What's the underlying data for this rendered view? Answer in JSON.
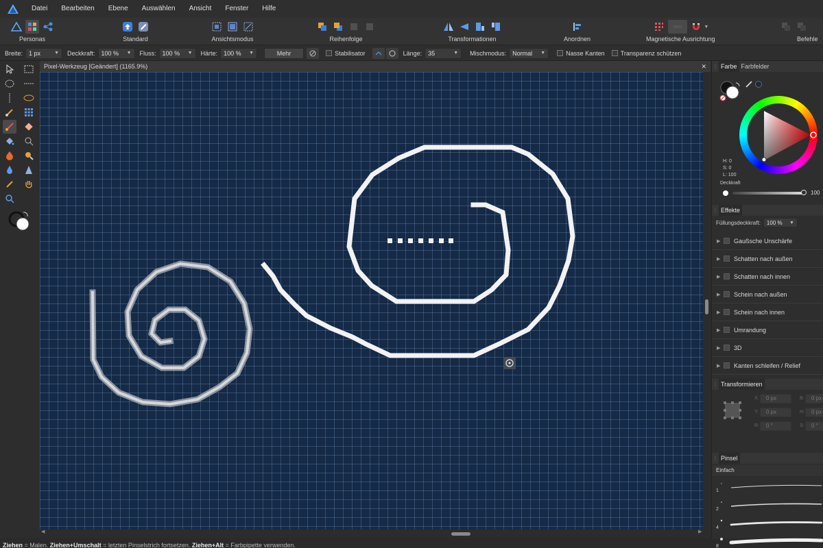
{
  "menubar": {
    "items": [
      "Datei",
      "Bearbeiten",
      "Ebene",
      "Auswählen",
      "Ansicht",
      "Fenster",
      "Hilfe"
    ]
  },
  "toolbar": {
    "personas_label": "Personas",
    "standard_label": "Standard",
    "ansichtsmodus_label": "Ansichtsmodus",
    "reihenfolge_label": "Reihenfolge",
    "transformationen_label": "Transformationen",
    "anordnen_label": "Anordnen",
    "magnetische_label": "Magnetische Ausrichtung",
    "befehle_label": "Befehle"
  },
  "context": {
    "breite_label": "Breite:",
    "breite_value": "1 px",
    "deckkraft_label": "Deckkraft:",
    "deckkraft_value": "100 %",
    "fluss_label": "Fluss:",
    "fluss_value": "100 %",
    "haerte_label": "Härte:",
    "haerte_value": "100 %",
    "mehr_label": "Mehr",
    "stabilisator_label": "Stabilisator",
    "laenge_label": "Länge:",
    "laenge_value": "35",
    "mischmodus_label": "Mischmodus:",
    "mischmodus_value": "Normal",
    "nasse_kanten_label": "Nasse Kanten",
    "transparenz_label": "Transparenz schützen"
  },
  "document": {
    "tab_title": "Pixel-Werkzeug [Geändert] (1165.9%)",
    "close_glyph": "✕"
  },
  "status": {
    "k1": "Ziehen",
    "t1": " = Malen. ",
    "k2": "Ziehen+Umschalt",
    "t2": " = letzten Pinselstrich fortsetzen. ",
    "k3": "Ziehen+Alt",
    "t3": " = Farbpipette verwenden."
  },
  "color_panel": {
    "tab_farbe": "Farbe",
    "tab_farbfelder": "Farbfelder",
    "h": "H: 0",
    "s": "S: 0",
    "l": "L: 100",
    "deckkraft_label": "Deckkraft",
    "deckkraft_value": "100"
  },
  "effects_panel": {
    "title": "Effekte",
    "fuellung_label": "Füllungsdeckkraft:",
    "fuellung_value": "100 %",
    "items": [
      "Gaußsche Unschärfe",
      "Schatten nach außen",
      "Schatten nach innen",
      "Schein nach außen",
      "Schein nach innen",
      "Umrandung",
      "3D",
      "Kanten schleifen / Relief"
    ]
  },
  "transform_panel": {
    "title": "Transformieren",
    "x": "0 px",
    "y": "0 px",
    "w": "0 px",
    "h": "0 px",
    "r": "0 °",
    "s": "0 °",
    "lx": "X:",
    "ly": "Y:",
    "lw": "B:",
    "lh": "H:",
    "lr": "R:",
    "ls": "S:"
  },
  "brush_panel": {
    "title": "Pinsel",
    "category": "Einfach",
    "sizes": [
      "1",
      "2",
      "4",
      "8"
    ]
  },
  "colors": {
    "canvas_bg": "#142a47",
    "accent": "#3d6fb6",
    "stroke": "#f2f2f2"
  }
}
